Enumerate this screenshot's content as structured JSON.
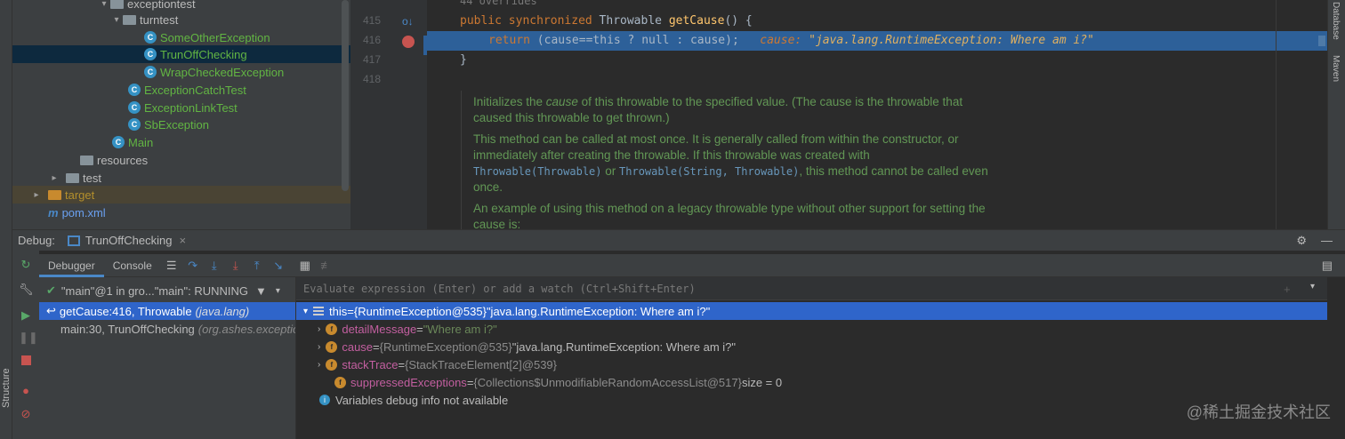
{
  "tree": {
    "partial_top": "exceptiontest",
    "turntest": "turntest",
    "items": [
      {
        "label": "SomeOtherException"
      },
      {
        "label": "TrunOffChecking"
      },
      {
        "label": "WrapCheckedException"
      },
      {
        "label": "ExceptionCatchTest"
      },
      {
        "label": "ExceptionLinkTest"
      },
      {
        "label": "SbException"
      },
      {
        "label": "Main"
      }
    ],
    "resources": "resources",
    "test": "test",
    "target": "target",
    "pom": "pom.xml"
  },
  "editor": {
    "overrides": "44 overrides",
    "line_numbers": [
      "415",
      "416",
      "417",
      "418"
    ],
    "line415": {
      "kw1": "public",
      "kw2": "synchronized",
      "type": "Throwable",
      "name": "getCause",
      "rest": "() {"
    },
    "line416": {
      "kw": "return",
      "expr": "(cause==this ? null : cause);",
      "inline_label": "cause:",
      "inline_value": "\"java.lang.RuntimeException: Where am i?\""
    },
    "line417": "}",
    "doc": {
      "p1a": "Initializes the ",
      "p1b": "cause",
      "p1c": " of this throwable to the specified value. (The cause is the throwable that caused this throwable to get thrown.)",
      "p2a": "This method can be called at most once. It is generally called from within the constructor, or immediately after creating the throwable. If this throwable was created with ",
      "p2code1": "Throwable(Throwable)",
      "p2b": " or ",
      "p2code2": "Throwable(String, Throwable)",
      "p2c": ", this method cannot be called even once.",
      "p3": "An example of using this method on a legacy throwable type without other support for setting the cause is:"
    },
    "right_tabs": [
      "Database",
      "Maven"
    ]
  },
  "debug": {
    "label": "Debug:",
    "session": "TrunOffChecking",
    "tabs": [
      "Debugger",
      "Console"
    ],
    "thread": "\"main\"@1 in gro...\"main\": RUNNING",
    "frames": [
      {
        "method": "getCause:416, Throwable",
        "pkg": "(java.lang)"
      },
      {
        "method": "main:30, TrunOffChecking",
        "pkg": "(org.ashes.exceptio"
      }
    ],
    "eval_placeholder": "Evaluate expression (Enter) or add a watch (Ctrl+Shift+Enter)",
    "vars": [
      {
        "name": "this",
        "eq": " = ",
        "type": "{RuntimeException@535}",
        "value": " \"java.lang.RuntimeException: Where am i?\""
      },
      {
        "name": "detailMessage",
        "eq": " = ",
        "type": "",
        "value": "\"Where am i?\""
      },
      {
        "name": "cause",
        "eq": " = ",
        "type": "{RuntimeException@535}",
        "value": " \"java.lang.RuntimeException: Where am i?\""
      },
      {
        "name": "stackTrace",
        "eq": " = ",
        "type": "{StackTraceElement[2]@539}",
        "value": ""
      },
      {
        "name": "suppressedExceptions",
        "eq": " = ",
        "type": "{Collections$UnmodifiableRandomAccessList@517}",
        "value": "  size = 0"
      }
    ],
    "info": "Variables debug info not available"
  },
  "left_tab": "Structure",
  "watermark": "@稀土掘金技术社区"
}
